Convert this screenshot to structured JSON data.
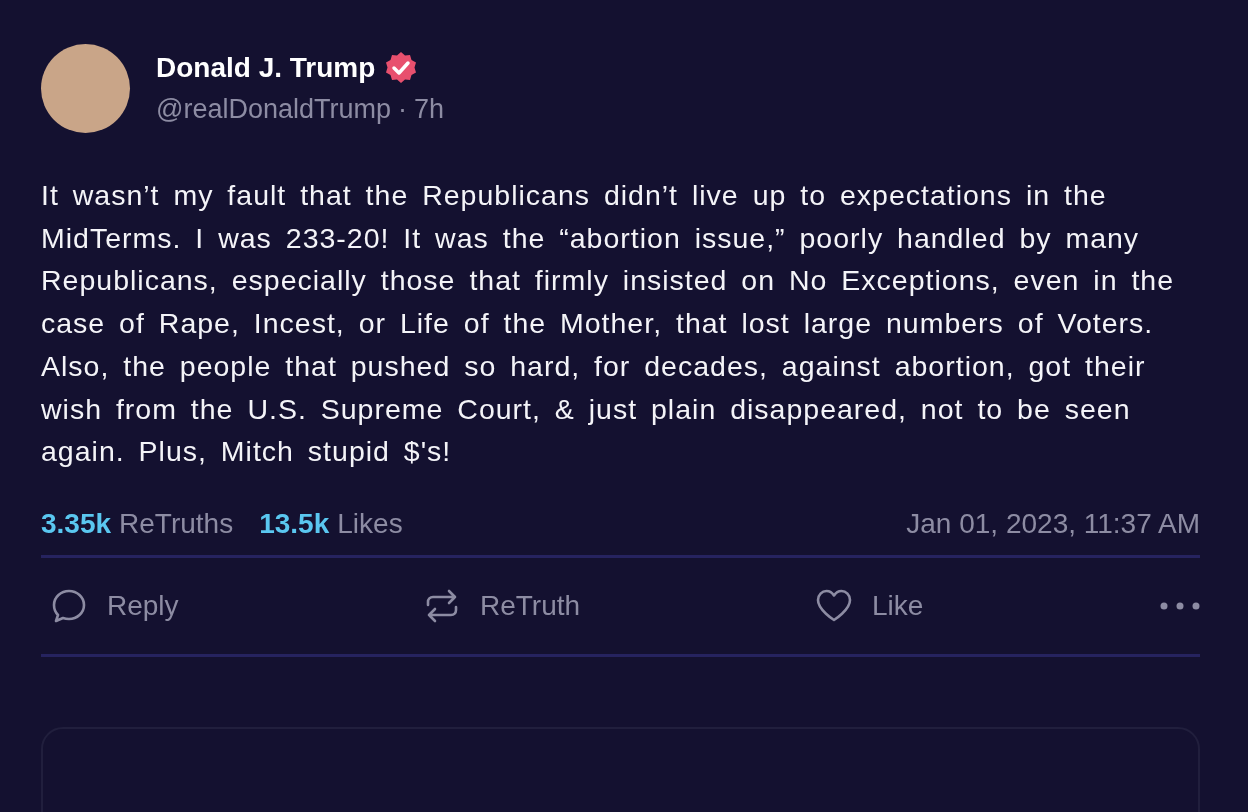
{
  "post": {
    "author": {
      "name": "Donald J. Trump",
      "verified": true,
      "handle": "@realDonaldTrump",
      "separator": "·",
      "time": "7h"
    },
    "text": "It wasn’t my fault that the Republicans didn’t live up to expectations in the MidTerms. I was 233-20! It was the “abortion issue,” poorly handled by many Republicans, especially those that firmly insisted on No Exceptions, even in the case of Rape, Incest, or Life of the Mother, that lost large numbers of Voters. Also, the people that pushed so hard, for decades, against abortion, got their wish from the U.S. Supreme Court, & just plain disappeared, not to be seen again. Plus, Mitch stupid $'s!",
    "stats": [
      {
        "count": "3.35k",
        "label": "ReTruths"
      },
      {
        "count": "13.5k",
        "label": "Likes"
      }
    ],
    "timestamp": "Jan 01, 2023, 11:37 AM",
    "actions": [
      {
        "kind": "reply",
        "label": "Reply"
      },
      {
        "kind": "retruth",
        "label": "ReTruth"
      },
      {
        "kind": "like",
        "label": "Like"
      },
      {
        "kind": "more"
      }
    ]
  }
}
